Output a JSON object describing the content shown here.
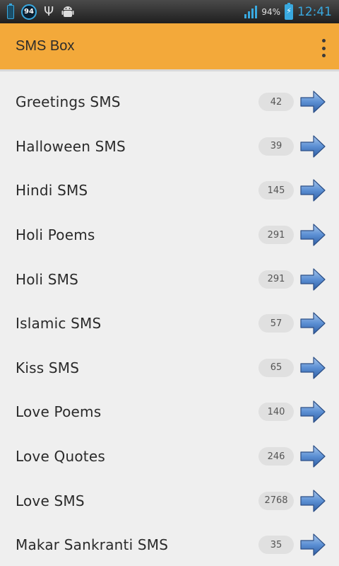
{
  "status_bar": {
    "notification_badge": "94",
    "battery_percent": "94%",
    "time": "12:41"
  },
  "action_bar": {
    "title": "SMS Box"
  },
  "colors": {
    "action_bar": "#f3a93a",
    "accent_blue": "#39a9e0",
    "arrow_blue": "#3f6fb4"
  },
  "list": [
    {
      "label": "Greetings SMS",
      "count": "42"
    },
    {
      "label": "Halloween SMS",
      "count": "39"
    },
    {
      "label": "Hindi SMS",
      "count": "145"
    },
    {
      "label": "Holi Poems",
      "count": "291"
    },
    {
      "label": "Holi SMS",
      "count": "291"
    },
    {
      "label": "Islamic SMS",
      "count": "57"
    },
    {
      "label": "Kiss SMS",
      "count": "65"
    },
    {
      "label": "Love Poems",
      "count": "140"
    },
    {
      "label": "Love Quotes",
      "count": "246"
    },
    {
      "label": "Love SMS",
      "count": "2768"
    },
    {
      "label": "Makar Sankranti SMS",
      "count": "35"
    }
  ]
}
